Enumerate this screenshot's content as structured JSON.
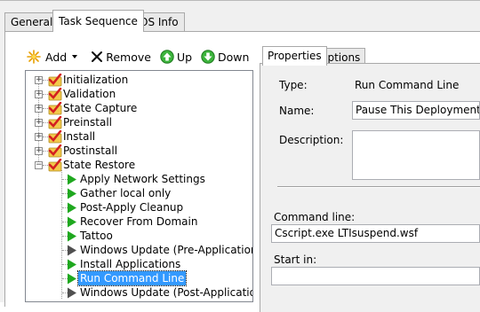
{
  "tabs": [
    {
      "label": "General"
    },
    {
      "label": "Task Sequence"
    },
    {
      "label": "OS Info"
    }
  ],
  "toolbar": {
    "add_label": "Add",
    "remove_label": "Remove",
    "up_label": "Up",
    "down_label": "Down"
  },
  "tree": {
    "groups": [
      {
        "label": "Initialization",
        "expanded": false
      },
      {
        "label": "Validation",
        "expanded": false
      },
      {
        "label": "State Capture",
        "expanded": false
      },
      {
        "label": "Preinstall",
        "expanded": false
      },
      {
        "label": "Install",
        "expanded": false
      },
      {
        "label": "Postinstall",
        "expanded": false
      },
      {
        "label": "State Restore",
        "expanded": true
      }
    ],
    "steps": [
      {
        "label": "Apply Network Settings",
        "icon": "green-play-icon"
      },
      {
        "label": "Gather local only",
        "icon": "green-play-icon"
      },
      {
        "label": "Post-Apply Cleanup",
        "icon": "green-play-icon"
      },
      {
        "label": "Recover From Domain",
        "icon": "green-play-icon"
      },
      {
        "label": "Tattoo",
        "icon": "green-play-icon"
      },
      {
        "label": "Windows Update (Pre-Application Installa",
        "icon": "gray-play-icon"
      },
      {
        "label": "Install Applications",
        "icon": "green-play-icon"
      },
      {
        "label": "Run Command Line",
        "icon": "green-play-icon",
        "selected": true
      },
      {
        "label": "Windows Update (Post-Application Installa",
        "icon": "gray-play-icon"
      }
    ]
  },
  "right_tabs": [
    {
      "label": "Properties"
    },
    {
      "label": "Options"
    }
  ],
  "properties": {
    "type_label": "Type:",
    "type_value": "Run Command Line",
    "name_label": "Name:",
    "name_value": "Pause This Deployment",
    "description_label": "Description:",
    "description_value": "",
    "command_line_label": "Command line:",
    "command_line_value": "Cscript.exe LTIsuspend.wsf",
    "start_in_label": "Start in:",
    "start_in_value": ""
  },
  "colors": {
    "selection": "#3399ff",
    "play_green": "#1fa81f",
    "play_gray": "#505050",
    "check_red": "#d42020",
    "folder_yellow": "#f2c94c"
  }
}
